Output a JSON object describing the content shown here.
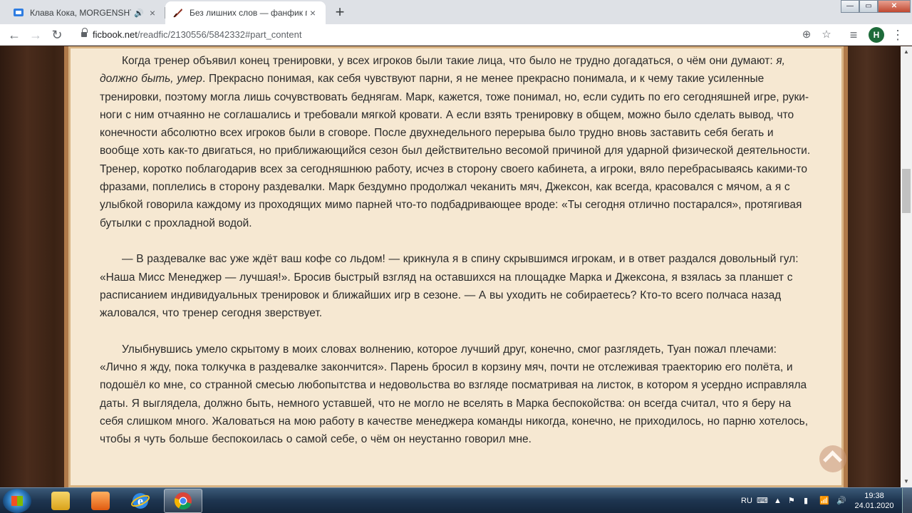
{
  "tabs": [
    {
      "title": "Клава Кока, MORGENSHTERN",
      "favicon": "chat-icon",
      "audio": true,
      "close": "×"
    },
    {
      "title": "Без лишних слов — фанфик по",
      "favicon": "quill-icon",
      "close": "×"
    }
  ],
  "newtab_label": "+",
  "window_controls": {
    "minimize": "—",
    "maximize": "▭",
    "close": "✕"
  },
  "toolbar": {
    "back": "←",
    "forward": "→",
    "reload": "↻",
    "url_host": "ficbook.net",
    "url_path": "/readfic/2130556/5842332#part_content",
    "zoom_icon": "⊕",
    "star_icon": "☆",
    "reading_list_icon": "≡",
    "profile_initial": "H",
    "menu_icon": "⋮"
  },
  "story": {
    "p1_a": "Когда тренер объявил конец тренировки, у всех игроков были такие лица, что было не трудно догадаться, о чём они думают: ",
    "p1_em": "я, должно быть, умер",
    "p1_b": ". Прекрасно понимая, как себя чувствуют парни, я не менее прекрасно понимала, и к чему такие усиленные тренировки, поэтому могла лишь сочувствовать беднягам. Марк, кажется, тоже понимал, но, если судить по его сегодняшней игре, руки-ноги с ним отчаянно не соглашались и требовали мягкой кровати. А если взять тренировку в общем, можно было сделать вывод, что конечности абсолютно всех игроков были в сговоре. После двухнедельного перерыва было трудно вновь заставить себя бегать и вообще хоть как-то двигаться, но приближающийся сезон был действительно весомой причиной для ударной физической деятельности. Тренер, коротко поблагодарив всех за сегодняшнюю работу, исчез в сторону своего кабинета, а игроки, вяло перебрасываясь какими-то фразами, поплелись в сторону раздевалки. Марк бездумно продолжал чеканить мяч, Джексон, как всегда, красовался с мячом, а я с улыбкой говорила каждому из проходящих мимо парней что-то подбадривающее вроде: «Ты сегодня отлично постарался», протягивая бутылки с прохладной водой.",
    "p2": "— В раздевалке вас уже ждёт ваш кофе со льдом! — крикнула я в спину скрывшимся игрокам, и в ответ раздался довольный гул: «Наша Мисс Менеджер — лучшая!». Бросив быстрый взгляд на оставшихся на площадке Марка и Джексона, я взялась за планшет с расписанием индивидуальных тренировок и ближайших игр в сезоне. — А вы уходить не собираетесь? Кто-то всего полчаса назад жаловался, что тренер сегодня зверствует.",
    "p3": "Улыбнувшись умело скрытому в моих словах волнению, которое лучший друг, конечно, смог разглядеть, Туан пожал плечами: «Лично я жду, пока толкучка в раздевалке закончится». Парень бросил в корзину мяч, почти не отслеживая траекторию его полёта, и подошёл ко мне, со странной смесью любопытства и недовольства во взгляде посматривая на листок, в котором я усердно исправляла даты. Я выглядела, должно быть, немного уставшей, что не могло не вселять в Марка беспокойства: он всегда считал, что я беру на себя слишком много. Жаловаться на мою работу в качестве менеджера команды никогда, конечно, не приходилось, но парню хотелось, чтобы я чуть больше беспокоилась о самой себе, о чём он неустанно говорил мне."
  },
  "taskbar": {
    "apps": [
      "explorer-icon",
      "media-player-icon",
      "internet-explorer-icon",
      "chrome-icon"
    ],
    "lang": "RU",
    "time": "19:38",
    "date": "24.01.2020"
  }
}
